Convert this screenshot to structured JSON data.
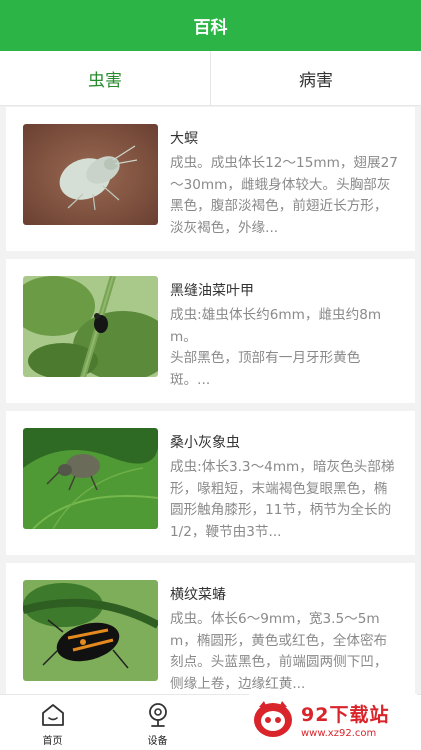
{
  "header": {
    "title": "百科"
  },
  "tabs": [
    {
      "label": "虫害",
      "active": true
    },
    {
      "label": "病害",
      "active": false
    }
  ],
  "colors": {
    "primary": "#2db446",
    "active_tab": "#2a8c2f",
    "watermark": "#d8242a"
  },
  "cards": [
    {
      "title": "大螟",
      "desc": "成虫。成虫体长12～15mm，翅展27～30mm，雌蛾身体较大。头胸部灰黑色，腹部淡褐色，前翅近长方形，淡灰褐色，外缘...",
      "image": "moth-photo"
    },
    {
      "title": "黑缝油菜叶甲",
      "desc": "成虫:雄虫体长约6mm，雌虫约8mm。\n头部黑色，顶部有一月牙形黄色斑。...",
      "image": "leaf-beetle-photo"
    },
    {
      "title": "桑小灰象虫",
      "desc": "成虫:体长3.3～4mm，暗灰色头部梯形，喙粗短，末端褐色复眼黑色，椭圆形触角膝形，11节，柄节为全长的1/2，鞭节由3节...",
      "image": "weevil-photo"
    },
    {
      "title": "横纹菜蝽",
      "desc": "成虫。体长6～9mm，宽3.5～5mm，椭圆形，黄色或红色，全体密布刻点。头蓝黑色，前端圆两侧下凹，侧缘上卷，边缘红黄...",
      "image": "stink-bug-photo"
    }
  ],
  "tabbar": [
    {
      "label": "首页",
      "icon": "home-icon"
    },
    {
      "label": "设备",
      "icon": "device-icon"
    }
  ],
  "watermark": {
    "title": "92下载站",
    "url": "www.xz92.com"
  }
}
